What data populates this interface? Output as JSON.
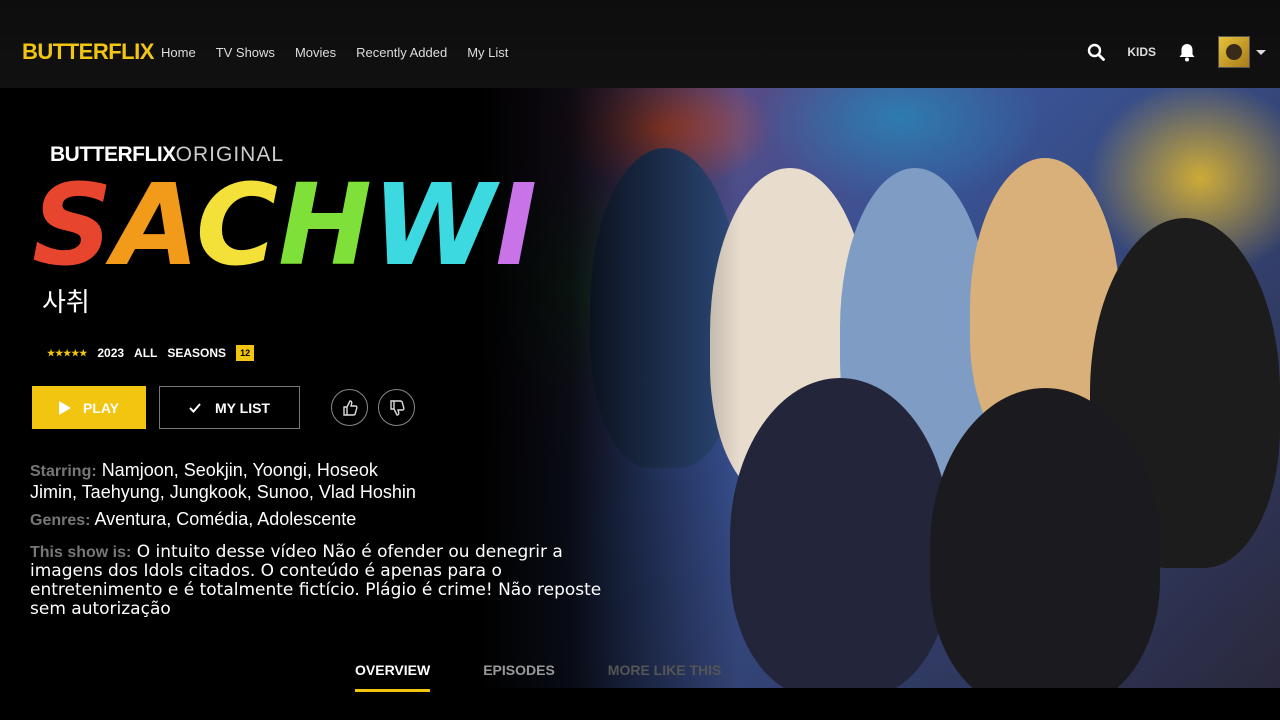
{
  "nav": {
    "logo": "BUTTERFLIX",
    "links": [
      "Home",
      "TV Shows",
      "Movies",
      "Recently Added",
      "My List"
    ],
    "kids": "KIDS"
  },
  "show": {
    "brand": "BUTTERFLIX",
    "brand_suffix": "ORIGINAL",
    "title_letters": [
      "S",
      "A",
      "C",
      "H",
      "W",
      "I"
    ],
    "title_colors": [
      "#e8452e",
      "#f29a1a",
      "#f3e13a",
      "#7fe03a",
      "#3dd9e0",
      "#c873e8"
    ],
    "korean": "사취",
    "stars": "★★★★★",
    "year": "2023",
    "audience": "ALL",
    "seasons_label": "SEASONS",
    "rating": "12"
  },
  "actions": {
    "play": "PLAY",
    "mylist": "MY LIST"
  },
  "details": {
    "starring_label": "Starring:",
    "starring_line1": "Namjoon, Seokjin, Yoongi, Hoseok",
    "starring_line2": "Jimin, Taehyung, Jungkook, Sunoo, Vlad Hoshin",
    "genres_label": "Genres:",
    "genres": "Aventura, Comédia, Adolescente",
    "about_label": "This show is:",
    "about": "O intuito desse vídeo Não é ofender ou denegrir a imagens dos Idols citados. O conteúdo é apenas para o entretenimento e é totalmente fictício. Plágio é crime! Não reposte sem autorização"
  },
  "tabs": [
    "OVERVIEW",
    "EPISODES",
    "MORE LIKE THIS"
  ]
}
